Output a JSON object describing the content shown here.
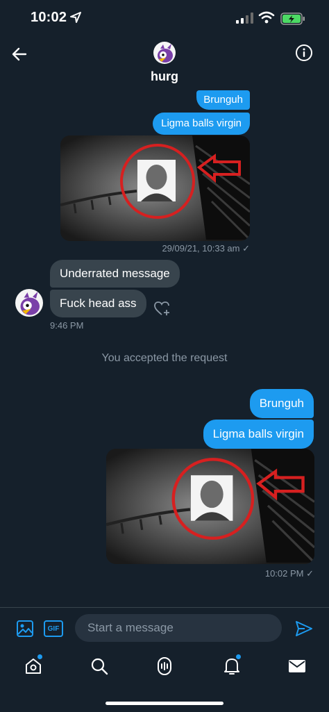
{
  "status_bar": {
    "time": "10:02"
  },
  "header": {
    "title": "hurg"
  },
  "conversation": {
    "top_outgoing": [
      "Brunguh",
      "Ligma balls virgin"
    ],
    "top_photo_timestamp": "29/09/21, 10:33 am ✓",
    "incoming": [
      "Underrated message",
      "Fuck head ass"
    ],
    "incoming_time": "9:46 PM",
    "system_note": "You accepted the request",
    "bottom_outgoing": [
      "Brunguh",
      "Ligma balls virgin"
    ],
    "bottom_photo_timestamp": "10:02 PM ✓"
  },
  "composer": {
    "placeholder": "Start a message",
    "gif_label": "GIF"
  },
  "icons": {
    "back": "back-arrow-icon",
    "info": "info-icon",
    "image": "image-icon",
    "gif": "gif-icon",
    "send": "send-icon",
    "like": "heart-plus-icon",
    "tabs": [
      "home-icon",
      "search-icon",
      "spaces-icon",
      "notifications-icon",
      "messages-icon"
    ]
  },
  "colors": {
    "background": "#15202b",
    "accent": "#1d9bf0",
    "incoming_bubble": "#38444d",
    "muted": "#8b98a5"
  }
}
